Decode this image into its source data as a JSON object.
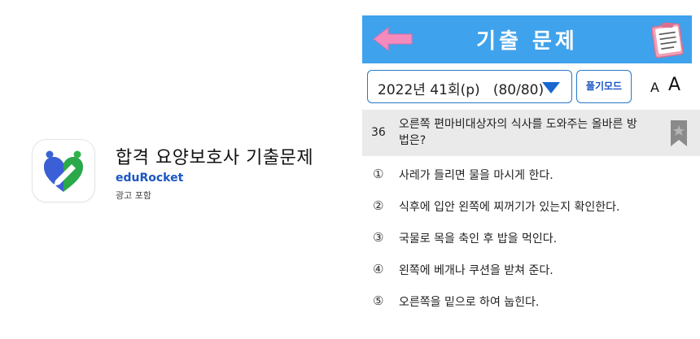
{
  "ad": {
    "title": "합격 요양보호사 기출문제",
    "developer": "eduRocket",
    "ad_label": "광고 포함",
    "icon": "heart-pencil-app-icon"
  },
  "app": {
    "header": {
      "title": "기출 문제",
      "back_icon": "pink-left-arrow-icon",
      "note_icon": "notepad-icon",
      "bar_color": "#3fa2ec"
    },
    "controls": {
      "round_select": "2022년 41회(p)   (80/80)",
      "mode_button": "풀기모드",
      "font_small": "A",
      "font_large": "A"
    },
    "question": {
      "number": "36",
      "text": "오른쪽 편마비대상자의 식사를 도와주는 올바른 방법은?"
    },
    "options": [
      {
        "mark": "①",
        "text": "사레가 들리면 물을 마시게 한다."
      },
      {
        "mark": "②",
        "text": "식후에 입안 왼쪽에 찌꺼기가 있는지 확인한다."
      },
      {
        "mark": "③",
        "text": "국물로 목을 축인 후 밥을 먹인다."
      },
      {
        "mark": "④",
        "text": "왼쪽에 베개나 쿠션을 받쳐 준다."
      },
      {
        "mark": "⑤",
        "text": "오른쪽을 밑으로 하여 눕힌다."
      }
    ]
  }
}
